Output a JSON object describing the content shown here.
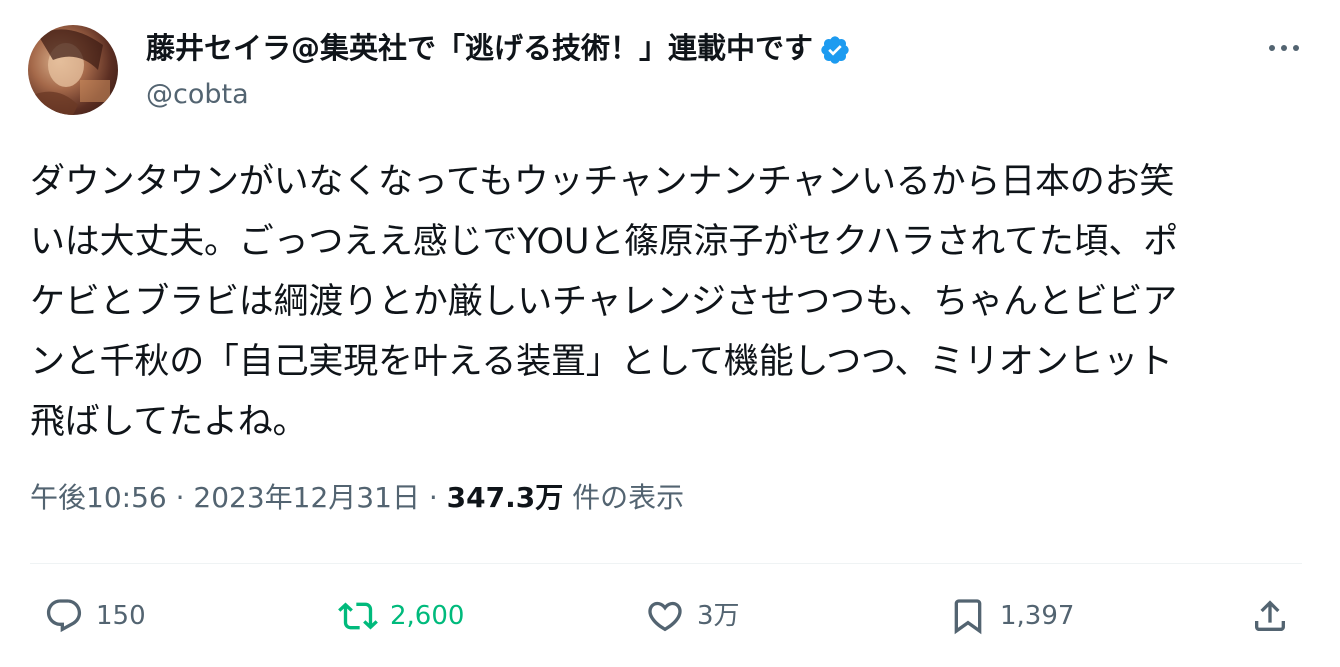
{
  "author": {
    "display_name": "藤井セイラ@集英社で「逃げる技術！」連載中です",
    "handle": "@cobta",
    "verified": true,
    "verified_color": "#1d9bf0"
  },
  "tweet": {
    "text_lines": [
      "ダウンタウンがいなくなってもウッチャンナンチャンいるから日本のお笑",
      "いは大丈夫。ごっつええ感じでYOUと篠原涼子がセクハラされてた頃、ポ",
      "ケビとブラビは綱渡りとか厳しいチャレンジさせつつも、ちゃんとビビア",
      "ンと千秋の「自己実現を叶える装置」として機能しつつ、ミリオンヒット",
      "飛ばしてたよね。"
    ],
    "time": "午後10:56",
    "separator": "·",
    "date": "2023年12月31日",
    "views_count": "347.3万",
    "views_label": "件の表示"
  },
  "actions": {
    "reply_count": "150",
    "retweet_count": "2,600",
    "like_count": "3万",
    "bookmark_count": "1,397"
  },
  "colors": {
    "text": "#0f1419",
    "secondary": "#536471",
    "retweet": "#00ba7c",
    "divider": "#eff3f4"
  },
  "icons": [
    "more-icon",
    "verified-badge-icon",
    "reply-icon",
    "retweet-icon",
    "like-icon",
    "bookmark-icon",
    "share-icon"
  ]
}
